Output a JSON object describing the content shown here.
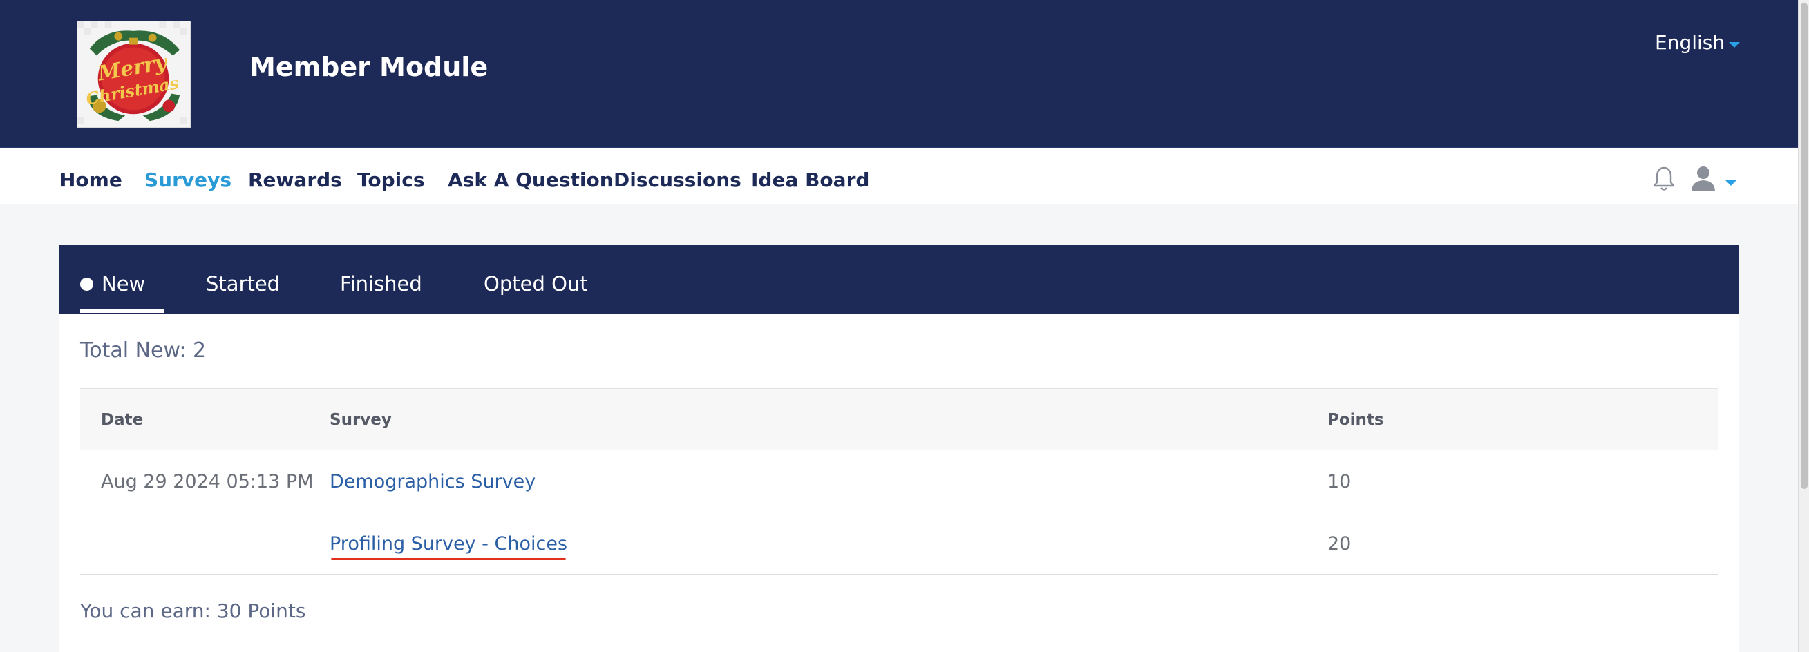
{
  "header": {
    "logo_text": "Merry Christmas",
    "title": "Member Module",
    "language": "English"
  },
  "nav": {
    "items": [
      {
        "label": "Home",
        "active": false
      },
      {
        "label": "Surveys",
        "active": true
      },
      {
        "label": "Rewards",
        "active": false
      },
      {
        "label": "Topics",
        "active": false
      },
      {
        "label": "Ask A Question",
        "active": false
      },
      {
        "label": "Discussions",
        "active": false
      },
      {
        "label": "Idea Board",
        "active": false
      }
    ],
    "bell_icon": "bell-icon",
    "user_icon": "user-icon"
  },
  "tabs": [
    {
      "label": "New",
      "active": true
    },
    {
      "label": "Started",
      "active": false
    },
    {
      "label": "Finished",
      "active": false
    },
    {
      "label": "Opted Out",
      "active": false
    }
  ],
  "panel": {
    "total_text": "Total New: 2",
    "columns": [
      "Date",
      "Survey",
      "Points"
    ],
    "rows": [
      {
        "date": "Aug 29 2024 05:13 PM",
        "survey": "Demographics Survey",
        "points": "10"
      },
      {
        "date": "",
        "survey": "Profiling Survey - Choices",
        "points": "20"
      }
    ],
    "earn_text": "You can earn: 30 Points"
  },
  "colors": {
    "header_bg": "#1d2a57",
    "accent": "#2a9ad6",
    "link": "#2a5fa5",
    "highlight_underline": "#e0301e"
  }
}
